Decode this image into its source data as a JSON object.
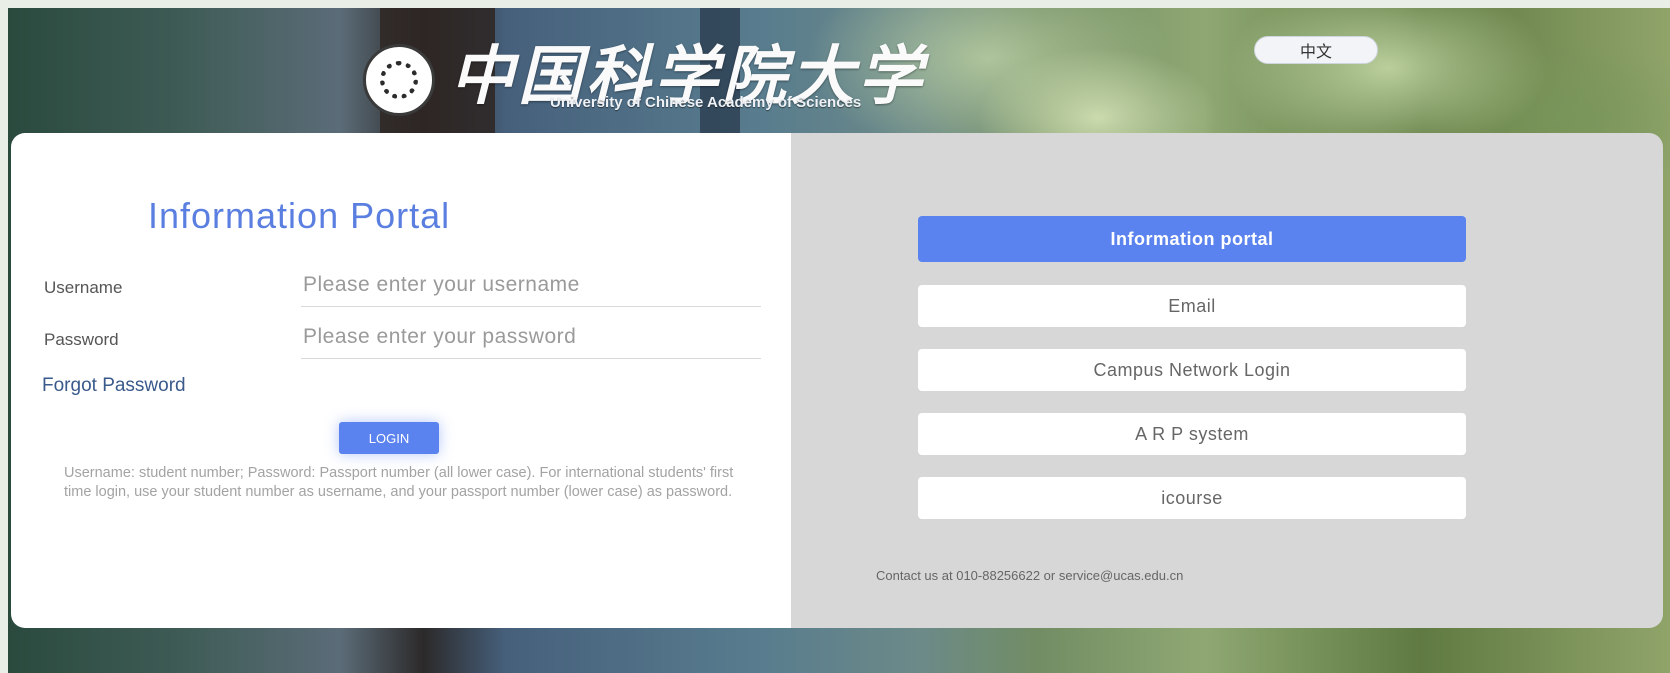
{
  "header": {
    "logo_cn": "中国科学院大学",
    "logo_en": "University of Chinese Academy of Sciences",
    "lang_label": "中文"
  },
  "login": {
    "title": "Information Portal",
    "username_label": "Username",
    "username_placeholder": "Please enter your username",
    "password_label": "Password",
    "password_placeholder": "Please enter your password",
    "forgot_label": "Forgot Password",
    "login_label": "LOGIN",
    "note": "Username: student number; Password: Passport number (all lower case). For international students' first time login, use your student number as username, and your passport number (lower case) as password."
  },
  "sidebar": {
    "buttons": [
      {
        "label": "Information portal"
      },
      {
        "label": "Email"
      },
      {
        "label": "Campus Network Login"
      },
      {
        "label": "A R P system"
      },
      {
        "label": "icourse"
      }
    ],
    "contact": "Contact us at 010-88256622 or service@ucas.edu.cn"
  },
  "colors": {
    "accent": "#5b83ef",
    "title": "#5b7fe0",
    "right_panel": "#d7d7d7"
  }
}
